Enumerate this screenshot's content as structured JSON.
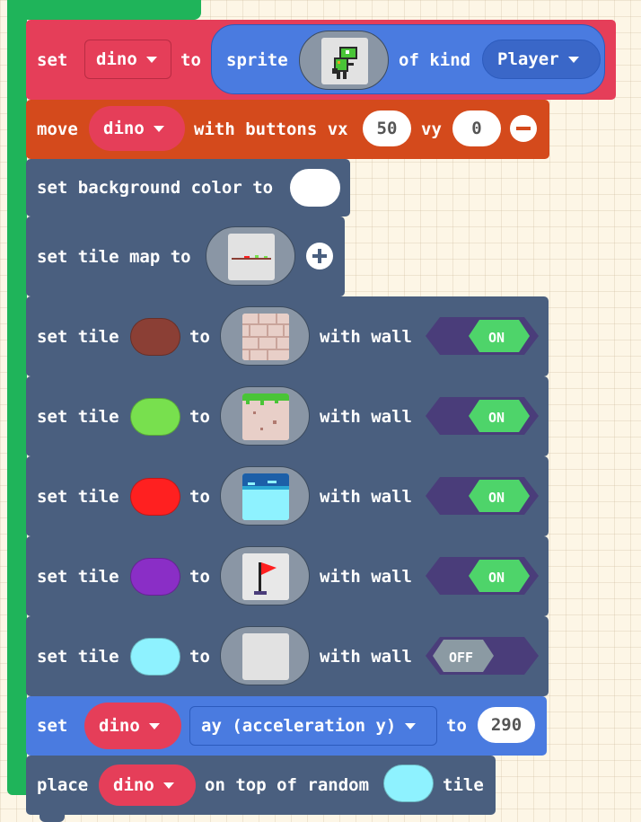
{
  "colors": {
    "pink": "#e53e59",
    "orange": "#d44a1c",
    "slate": "#4a5f7f",
    "blue": "#4a7be0",
    "green": "#1fb45a",
    "toggle_on": "#4ed46a",
    "toggle_off": "#8b9aa3",
    "toggle_bg": "#4a3d7a"
  },
  "blocks": {
    "set_sprite": {
      "set": "set",
      "var": "dino",
      "to": "to",
      "sprite": "sprite",
      "of_kind": "of kind",
      "kind": "Player"
    },
    "move": {
      "move": "move",
      "var": "dino",
      "with_buttons": "with buttons vx",
      "vx": "50",
      "vy_label": "vy",
      "vy": "0"
    },
    "bg": {
      "label": "set background color to"
    },
    "tilemap": {
      "label": "set tile map to"
    },
    "tiles": [
      {
        "set_tile": "set tile",
        "to": "to",
        "with_wall": "with wall",
        "color": "#8b3f35",
        "image": "brick-wall-image",
        "wall": "ON",
        "on": true
      },
      {
        "set_tile": "set tile",
        "to": "to",
        "with_wall": "with wall",
        "color": "#78e04e",
        "image": "grass-dirt-image",
        "wall": "ON",
        "on": true
      },
      {
        "set_tile": "set tile",
        "to": "to",
        "with_wall": "with wall",
        "color": "#ff2020",
        "image": "water-image",
        "wall": "ON",
        "on": true
      },
      {
        "set_tile": "set tile",
        "to": "to",
        "with_wall": "with wall",
        "color": "#8a2ec6",
        "image": "red-flag-image",
        "wall": "ON",
        "on": true
      },
      {
        "set_tile": "set tile",
        "to": "to",
        "with_wall": "with wall",
        "color": "#8ef2ff",
        "image": "blank-tile-image",
        "wall": "OFF",
        "on": false
      }
    ],
    "accel": {
      "set": "set",
      "var": "dino",
      "prop": "ay (acceleration y)",
      "to": "to",
      "value": "290"
    },
    "place": {
      "place": "place",
      "var": "dino",
      "on_top": "on top of random",
      "tile": "tile",
      "color": "#8ef2ff"
    }
  }
}
